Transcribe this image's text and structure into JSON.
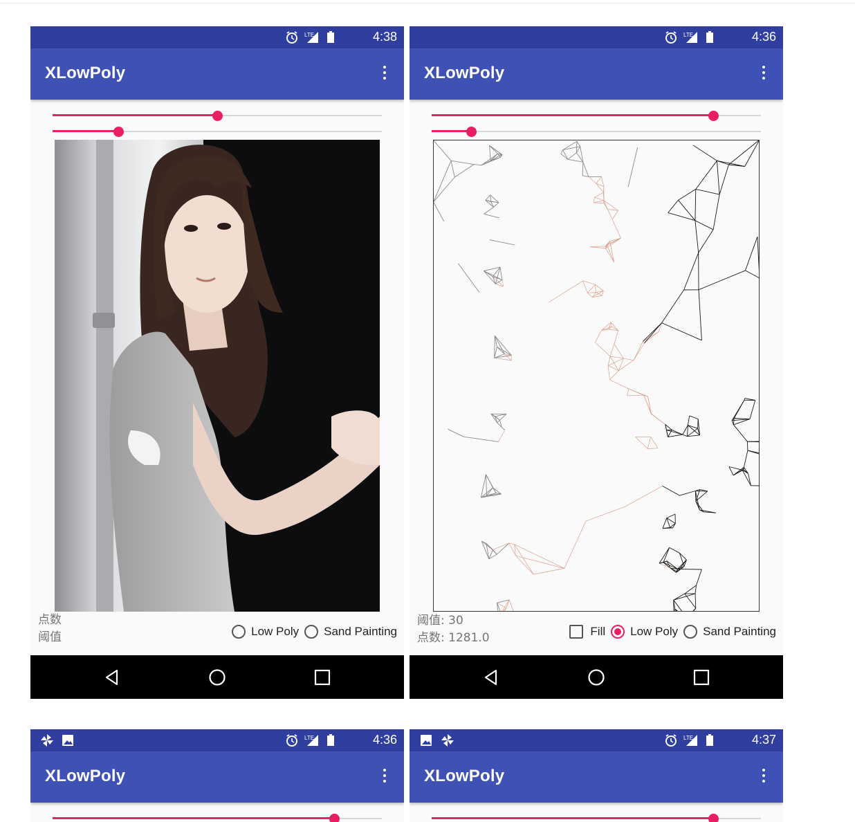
{
  "app": {
    "title": "XLowPoly"
  },
  "screens": [
    {
      "time": "4:38",
      "left_icons": [],
      "slider_points": 0.5,
      "slider_threshold": 0.2,
      "points_text": "点数",
      "threshold_text": "阈值",
      "options": {
        "low_poly": "Low Poly",
        "sand_painting": "Sand Painting"
      },
      "selected": "none",
      "image": "photo"
    },
    {
      "time": "4:36",
      "left_icons": [],
      "slider_points": 0.855,
      "slider_threshold": 0.12,
      "threshold_text": "阈值: 30",
      "points_text": "点数: 1281.0",
      "fill_label": "Fill",
      "fill_checked": false,
      "options": {
        "low_poly": "Low Poly",
        "sand_painting": "Sand Painting"
      },
      "selected": "low_poly",
      "image": "lowpoly"
    },
    {
      "time": "4:36",
      "left_icons": [
        "pinwheel-icon",
        "image-icon"
      ],
      "slider_points": 0.855
    },
    {
      "time": "4:37",
      "left_icons": [
        "image-icon",
        "pinwheel-icon"
      ],
      "slider_points": 0.855
    }
  ],
  "colors": {
    "primary": "#3f51b5",
    "primary_dark": "#303f9f",
    "accent": "#e91e63"
  },
  "icons": {
    "status": [
      "alarm-icon",
      "lte-signal-icon",
      "battery-icon"
    ],
    "nav": [
      "back-icon",
      "home-icon",
      "recents-icon"
    ],
    "menu": "more-vert-icon"
  }
}
